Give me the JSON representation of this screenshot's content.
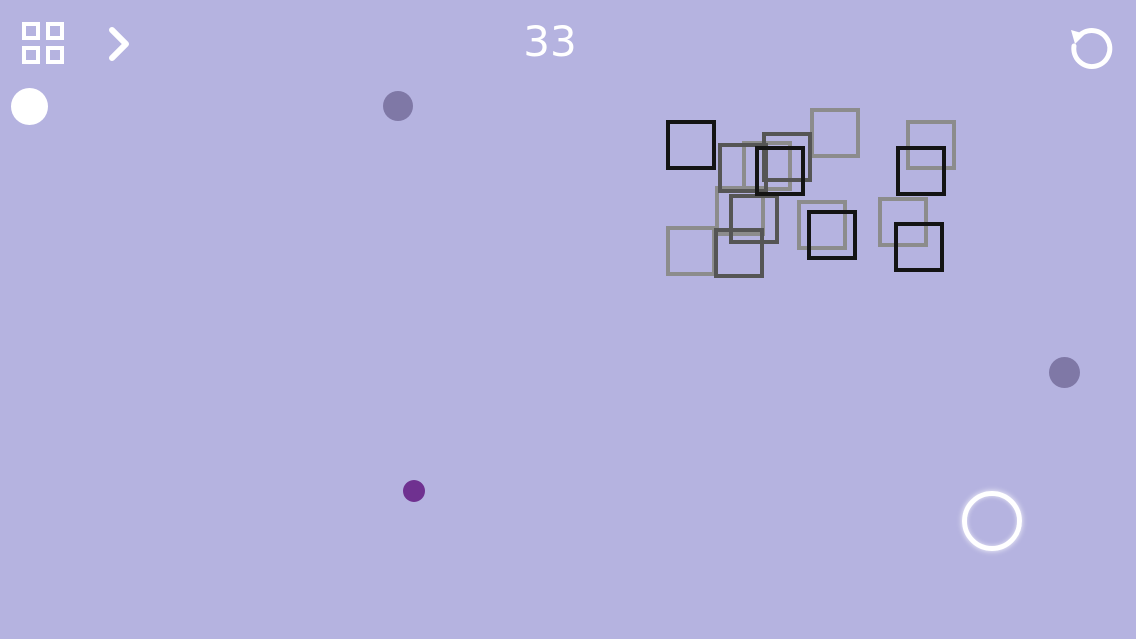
{
  "hud": {
    "level": "33",
    "menu_icon": "grid-icon",
    "next_icon": "chevron-right-icon",
    "restart_icon": "restart-icon"
  },
  "colors": {
    "background": "#b5b3e0",
    "white": "#ffffff",
    "gray_dot": "#7f78a6",
    "purple_dot": "#6f3190",
    "square_dark": "#141414",
    "square_mid": "#555555",
    "square_light": "#8c8c8c"
  },
  "objects": {
    "player": "white-dot",
    "goal": "ring",
    "obstacles": "squares"
  }
}
